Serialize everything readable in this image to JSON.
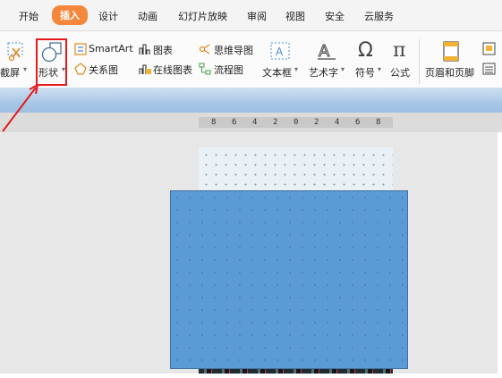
{
  "tabs": [
    {
      "label": "开始",
      "active": false
    },
    {
      "label": "插入",
      "active": true
    },
    {
      "label": "设计",
      "active": false
    },
    {
      "label": "动画",
      "active": false
    },
    {
      "label": "幻灯片放映",
      "active": false
    },
    {
      "label": "审阅",
      "active": false
    },
    {
      "label": "视图",
      "active": false
    },
    {
      "label": "安全",
      "active": false
    },
    {
      "label": "云服务",
      "active": false
    }
  ],
  "ribbon": {
    "screenshot": "截屏",
    "shape": "形状",
    "smartart": "SmartArt",
    "chart": "图表",
    "mindmap": "思维导图",
    "relation": "关系图",
    "online_chart": "在线图表",
    "flowchart": "流程图",
    "textbox": "文本框",
    "wordart": "艺术字",
    "symbol": "符号",
    "formula": "公式",
    "header_footer": "页眉和页脚"
  },
  "ruler": {
    "ticks": [
      "8",
      "6",
      "4",
      "2",
      "0",
      "2",
      "4",
      "6",
      "8"
    ]
  },
  "colors": {
    "active_tab": "#f5873c",
    "highlight": "#e31b1b",
    "shape_fill": "#5b9bd5"
  }
}
